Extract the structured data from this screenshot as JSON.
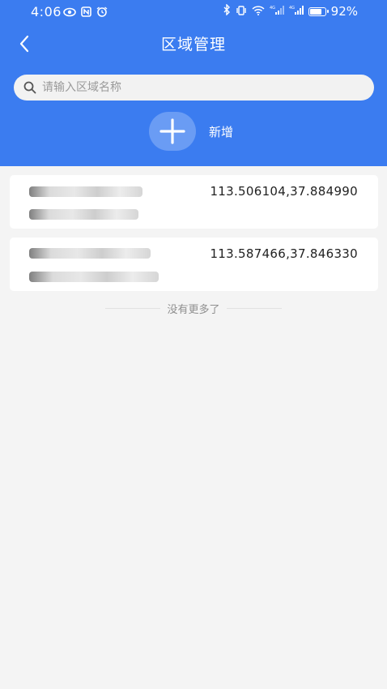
{
  "status_bar": {
    "time": "4:06",
    "battery_percent": "92%",
    "battery_level": 0.92,
    "network_label_1": "4G",
    "network_label_2": "4G"
  },
  "header": {
    "title": "区域管理",
    "back_icon": "chevron-left-icon"
  },
  "search": {
    "placeholder": "请输入区域名称",
    "value": "",
    "icon": "search-icon"
  },
  "add": {
    "icon": "plus-icon",
    "label": "新增"
  },
  "regions": [
    {
      "coords": "113.506104,37.884990"
    },
    {
      "coords": "113.587466,37.846330"
    }
  ],
  "footer": {
    "no_more_text": "没有更多了"
  },
  "colors": {
    "header_bg": "#3b7cf0",
    "page_bg": "#f4f4f4",
    "add_button_bg": "#6a9cf4"
  }
}
